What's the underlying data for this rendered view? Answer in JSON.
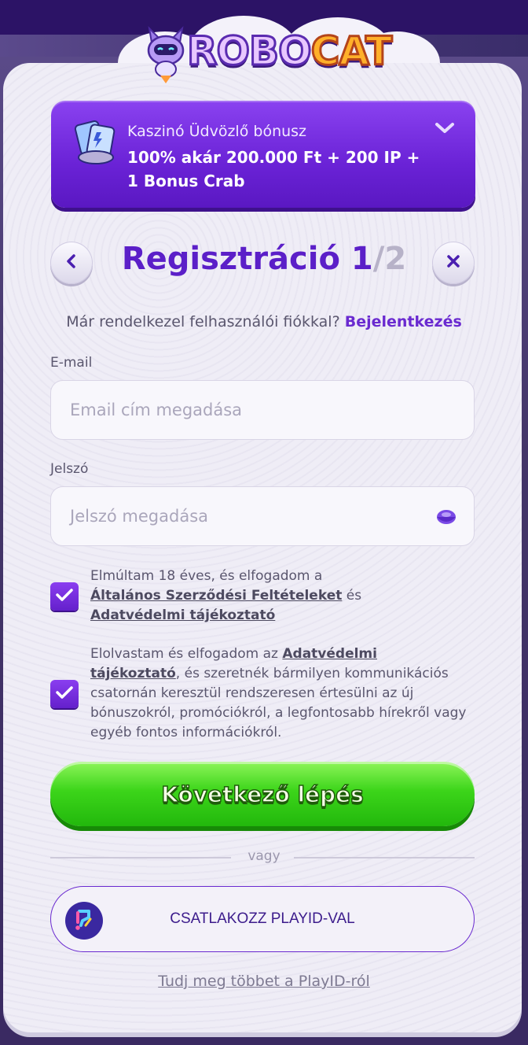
{
  "brand": {
    "logo_text_left": "ROBO",
    "logo_text_right": "CAT"
  },
  "bonus": {
    "title": "Kaszinó Üdvözlő bónusz",
    "line1": "100% akár 200.000 Ft + 200 IP +",
    "line2": "1 Bonus Crab"
  },
  "header": {
    "title_main": "Regisztráció 1",
    "title_total": "/2"
  },
  "login_prompt": {
    "text": "Már rendelkezel felhasználói fiókkal?",
    "link": "Bejelentkezés"
  },
  "email": {
    "label": "E-mail",
    "placeholder": "Email cím megadása"
  },
  "password": {
    "label": "Jelszó",
    "placeholder": "Jelszó megadása"
  },
  "consent_terms": {
    "checked": true,
    "text_before": "Elmúltam 18 éves, és elfogadom a",
    "link_terms": "Általános Szerződési Feltételeket",
    "text_and": "és",
    "link_privacy": "Adatvédelmi tájékoztató"
  },
  "consent_marketing": {
    "checked": true,
    "text_before": "Elolvastam és elfogadom az",
    "link_privacy": "Adatvédelmi tájékoztató",
    "text_after": ", és szeretnék bármilyen kommunikációs csatornán keresztül rendszeresen értesülni az új bónuszokról, promóciókról, a legfontosabb hírekről vagy egyéb fontos információkról."
  },
  "next_button": "Következő lépés",
  "divider": "vagy",
  "playid_button": "CSATLAKOZZ PLAYID-VAL",
  "learn_more": "Tudj meg többet a PlayID-ról",
  "colors": {
    "accent": "#6a2ad0",
    "primary_green": "#3cd51a",
    "bonus_purple": "#7a32e2"
  }
}
